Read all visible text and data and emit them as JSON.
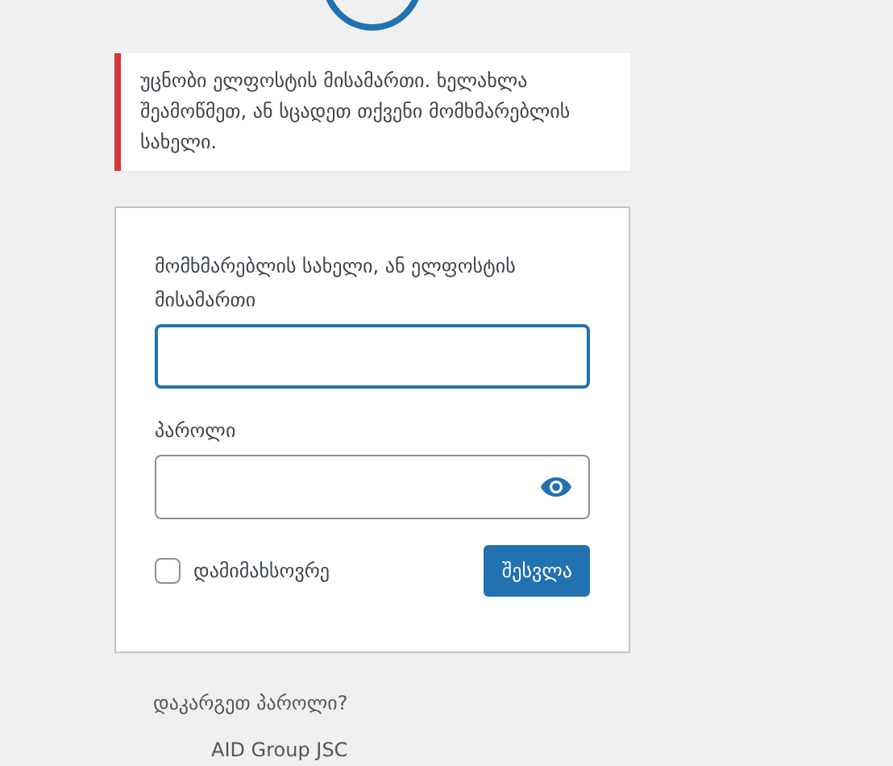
{
  "notice": {
    "text": "უცნობი ელფოსტის მისამართი. ხელახლა შეამოწმეთ, ან სცადეთ თქვენი მომხმარებლის სახელი."
  },
  "form": {
    "username_label": "მომხმარებლის სახელი, ან ელფოსტის მისამართი",
    "username_focused": true,
    "password_label": "პაროლი",
    "remember": {
      "label": "დამიმახსოვრე",
      "checked": false
    },
    "submit": "შესვლა"
  },
  "lost_password": "დაკარგეთ პაროლი?",
  "back_link": "AID Group JSC"
}
